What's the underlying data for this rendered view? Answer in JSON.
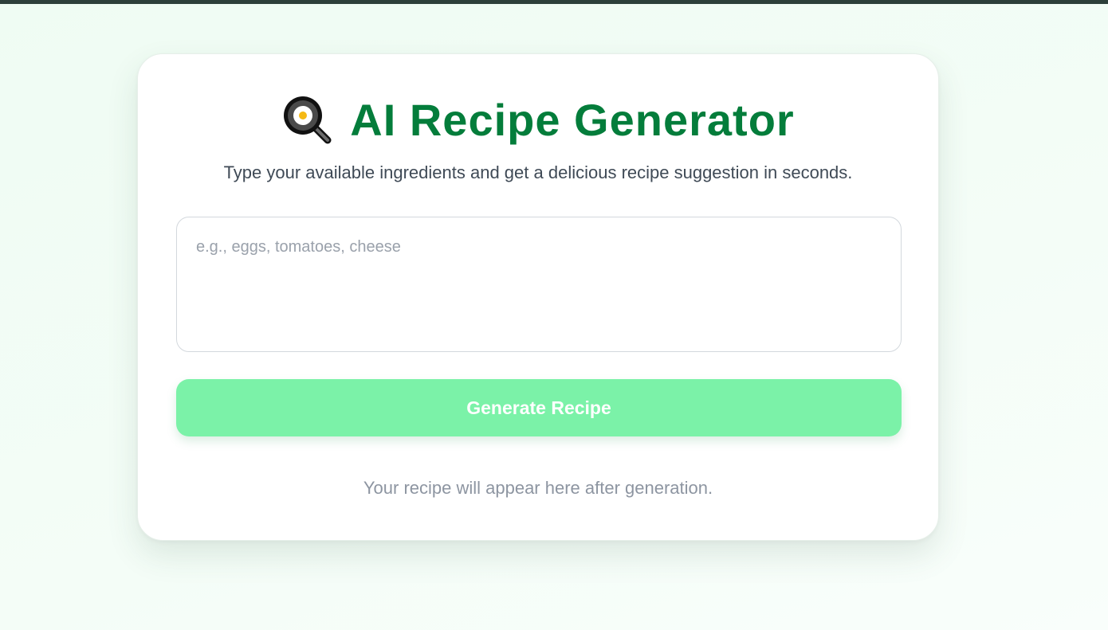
{
  "header": {
    "icon": "frying-pan-egg-icon",
    "title": "AI Recipe Generator",
    "subtitle": "Type your available ingredients and get a delicious recipe suggestion in seconds."
  },
  "form": {
    "ingredients_value": "",
    "ingredients_placeholder": "e.g., eggs, tomatoes, cheese",
    "generate_label": "Generate Recipe"
  },
  "result": {
    "placeholder_text": "Your recipe will appear here after generation."
  },
  "colors": {
    "title": "#047d3b",
    "button": "#7bf2a8",
    "background": "#effcf3"
  }
}
